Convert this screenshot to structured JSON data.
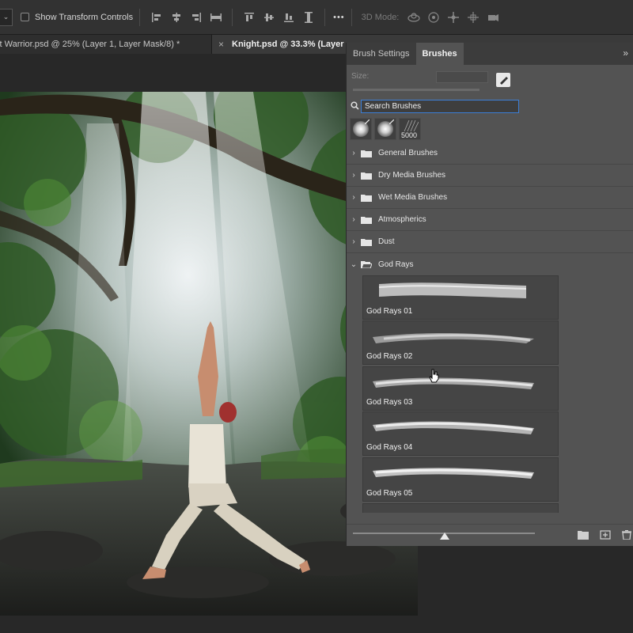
{
  "options_bar": {
    "show_transform_controls": "Show Transform Controls",
    "mode_label": "3D Mode:",
    "more_label": "•••",
    "dropdown_glyph": "⌄",
    "icons": [
      "align-left-icon",
      "align-center-icon",
      "align-right-icon",
      "distribute-icon",
      "align-top-icon",
      "align-middle-icon",
      "align-bottom-icon",
      "distribute-vertical-icon",
      "orbit-3d-icon",
      "roll-3d-icon",
      "pan-3d-icon",
      "slide-3d-icon",
      "scale-3d-icon"
    ]
  },
  "document_tabs": [
    {
      "label": "st Warrior.psd @ 25% (Layer 1, Layer Mask/8) *",
      "active": false
    },
    {
      "close_glyph": "×",
      "label": "Knight.psd @ 33.3% (Layer",
      "active": true
    }
  ],
  "panel": {
    "tabs": [
      {
        "label": "Brush Settings",
        "active": false
      },
      {
        "label": "Brushes",
        "active": true
      }
    ],
    "menu_glyph": "»",
    "size_label": "Size:",
    "search_value": "Search Brushes",
    "recent_brush_count": "5000",
    "groups": [
      {
        "label": "General Brushes",
        "expanded": false,
        "chevron": "›"
      },
      {
        "label": "Dry Media Brushes",
        "expanded": false,
        "chevron": "›"
      },
      {
        "label": "Wet Media Brushes",
        "expanded": false,
        "chevron": "›"
      },
      {
        "label": "Atmospherics",
        "expanded": false,
        "chevron": "›"
      },
      {
        "label": "Dust",
        "expanded": false,
        "chevron": "›"
      },
      {
        "label": "God Rays",
        "expanded": true,
        "chevron": "⌄"
      }
    ],
    "brushes": [
      {
        "name": "God Rays 01"
      },
      {
        "name": "God Rays 02"
      },
      {
        "name": "God Rays 03"
      },
      {
        "name": "God Rays 04"
      },
      {
        "name": "God Rays 05"
      }
    ]
  },
  "colors": {
    "chrome_dark": "#282828",
    "panel_bg": "#535353",
    "search_focus": "#3d7fd6"
  }
}
